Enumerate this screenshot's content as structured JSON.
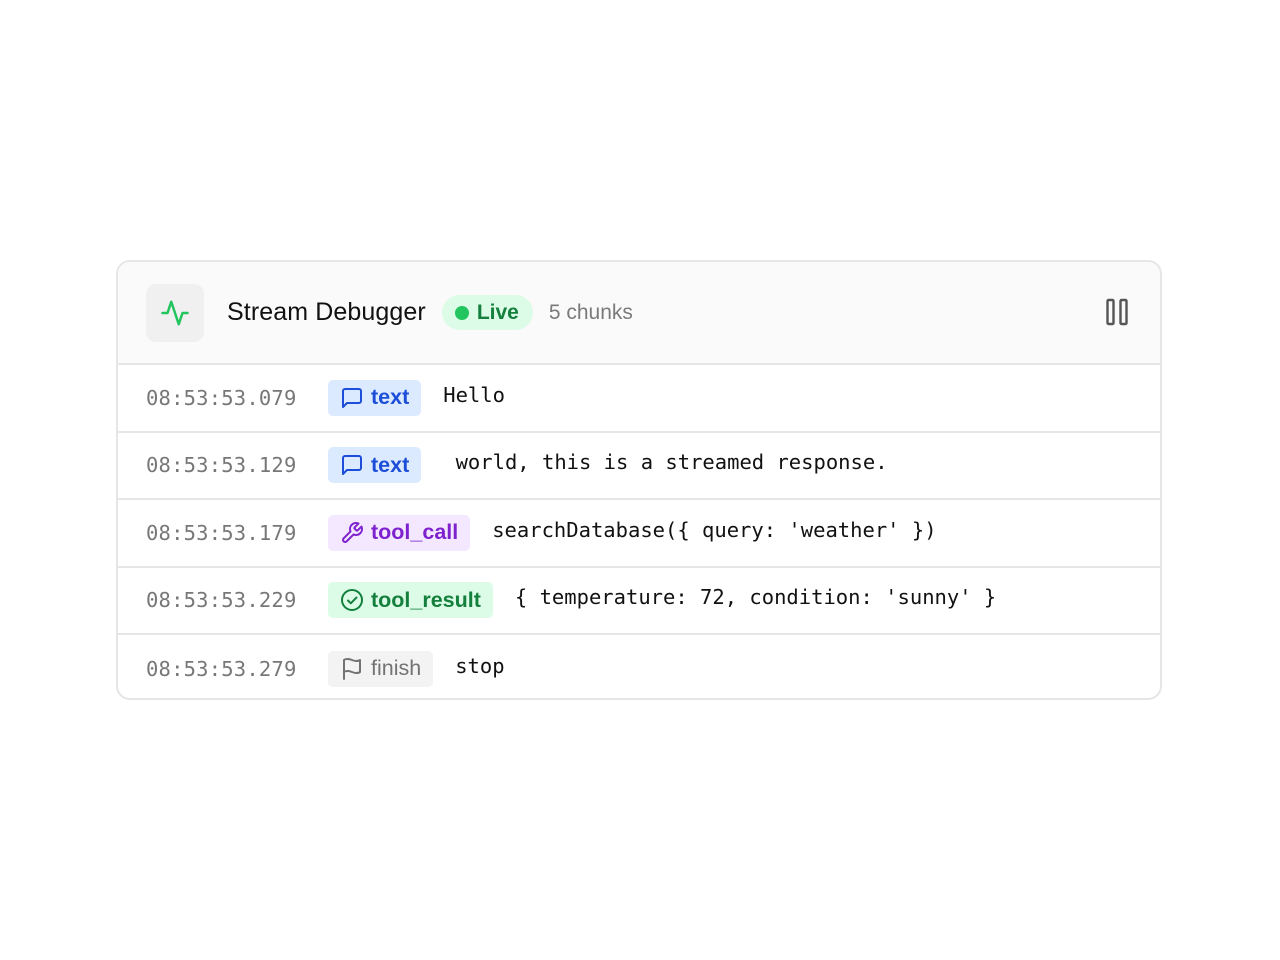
{
  "header": {
    "title": "Stream Debugger",
    "live_label": "Live",
    "chunk_count": "5 chunks",
    "app_icon": "activity-icon",
    "pause_icon": "pause-icon"
  },
  "colors": {
    "live_green": "#22c55e",
    "text_tag": "#1d4ed8",
    "tool_call_tag": "#7e22ce",
    "tool_result_tag": "#15803d",
    "finish_tag": "#737373"
  },
  "chunks": [
    {
      "timestamp": "08:53:53.079",
      "type": "text",
      "icon": "message-square-icon",
      "payload": "Hello"
    },
    {
      "timestamp": "08:53:53.129",
      "type": "text",
      "icon": "message-square-icon",
      "payload": " world, this is a streamed response."
    },
    {
      "timestamp": "08:53:53.179",
      "type": "tool_call",
      "icon": "wrench-icon",
      "payload": "searchDatabase({ query: 'weather' })"
    },
    {
      "timestamp": "08:53:53.229",
      "type": "tool_result",
      "icon": "check-circle-icon",
      "payload": "{ temperature: 72, condition: 'sunny' }"
    },
    {
      "timestamp": "08:53:53.279",
      "type": "finish",
      "icon": "flag-icon",
      "payload": "stop"
    }
  ]
}
